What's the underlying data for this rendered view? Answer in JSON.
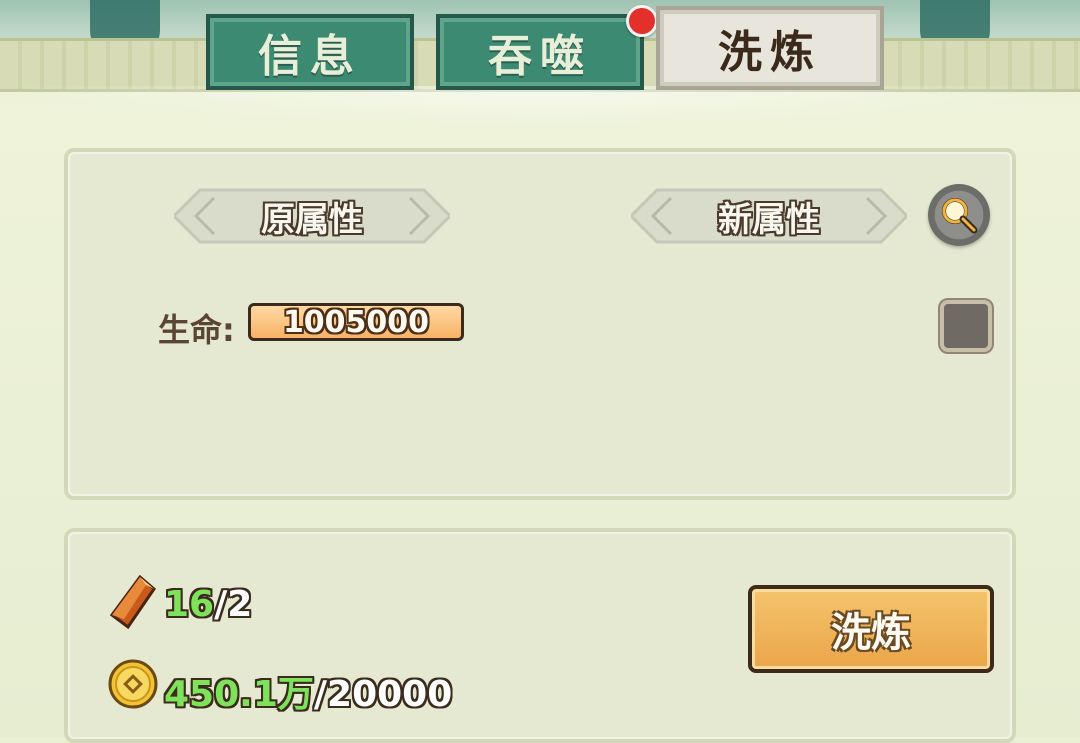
{
  "tabs": [
    {
      "label": "信息",
      "active": false
    },
    {
      "label": "吞噬",
      "active": false,
      "badge": true
    },
    {
      "label": "洗炼",
      "active": true
    }
  ],
  "attributes_panel": {
    "original_header": "原属性",
    "new_header": "新属性",
    "stat": {
      "label": "生命:",
      "value": "1005000"
    }
  },
  "cost_panel": {
    "crystal": {
      "icon": "crystal-icon",
      "amount": "16",
      "required": "/2"
    },
    "coin": {
      "icon": "coin-icon",
      "amount": "450.1万",
      "required": "/20000"
    },
    "refine_button": "洗炼"
  },
  "colors": {
    "accent_orange": "#f0ae52",
    "green_text": "#7ee35b",
    "tab_green": "#3d8a72",
    "badge_red": "#e2312b"
  }
}
